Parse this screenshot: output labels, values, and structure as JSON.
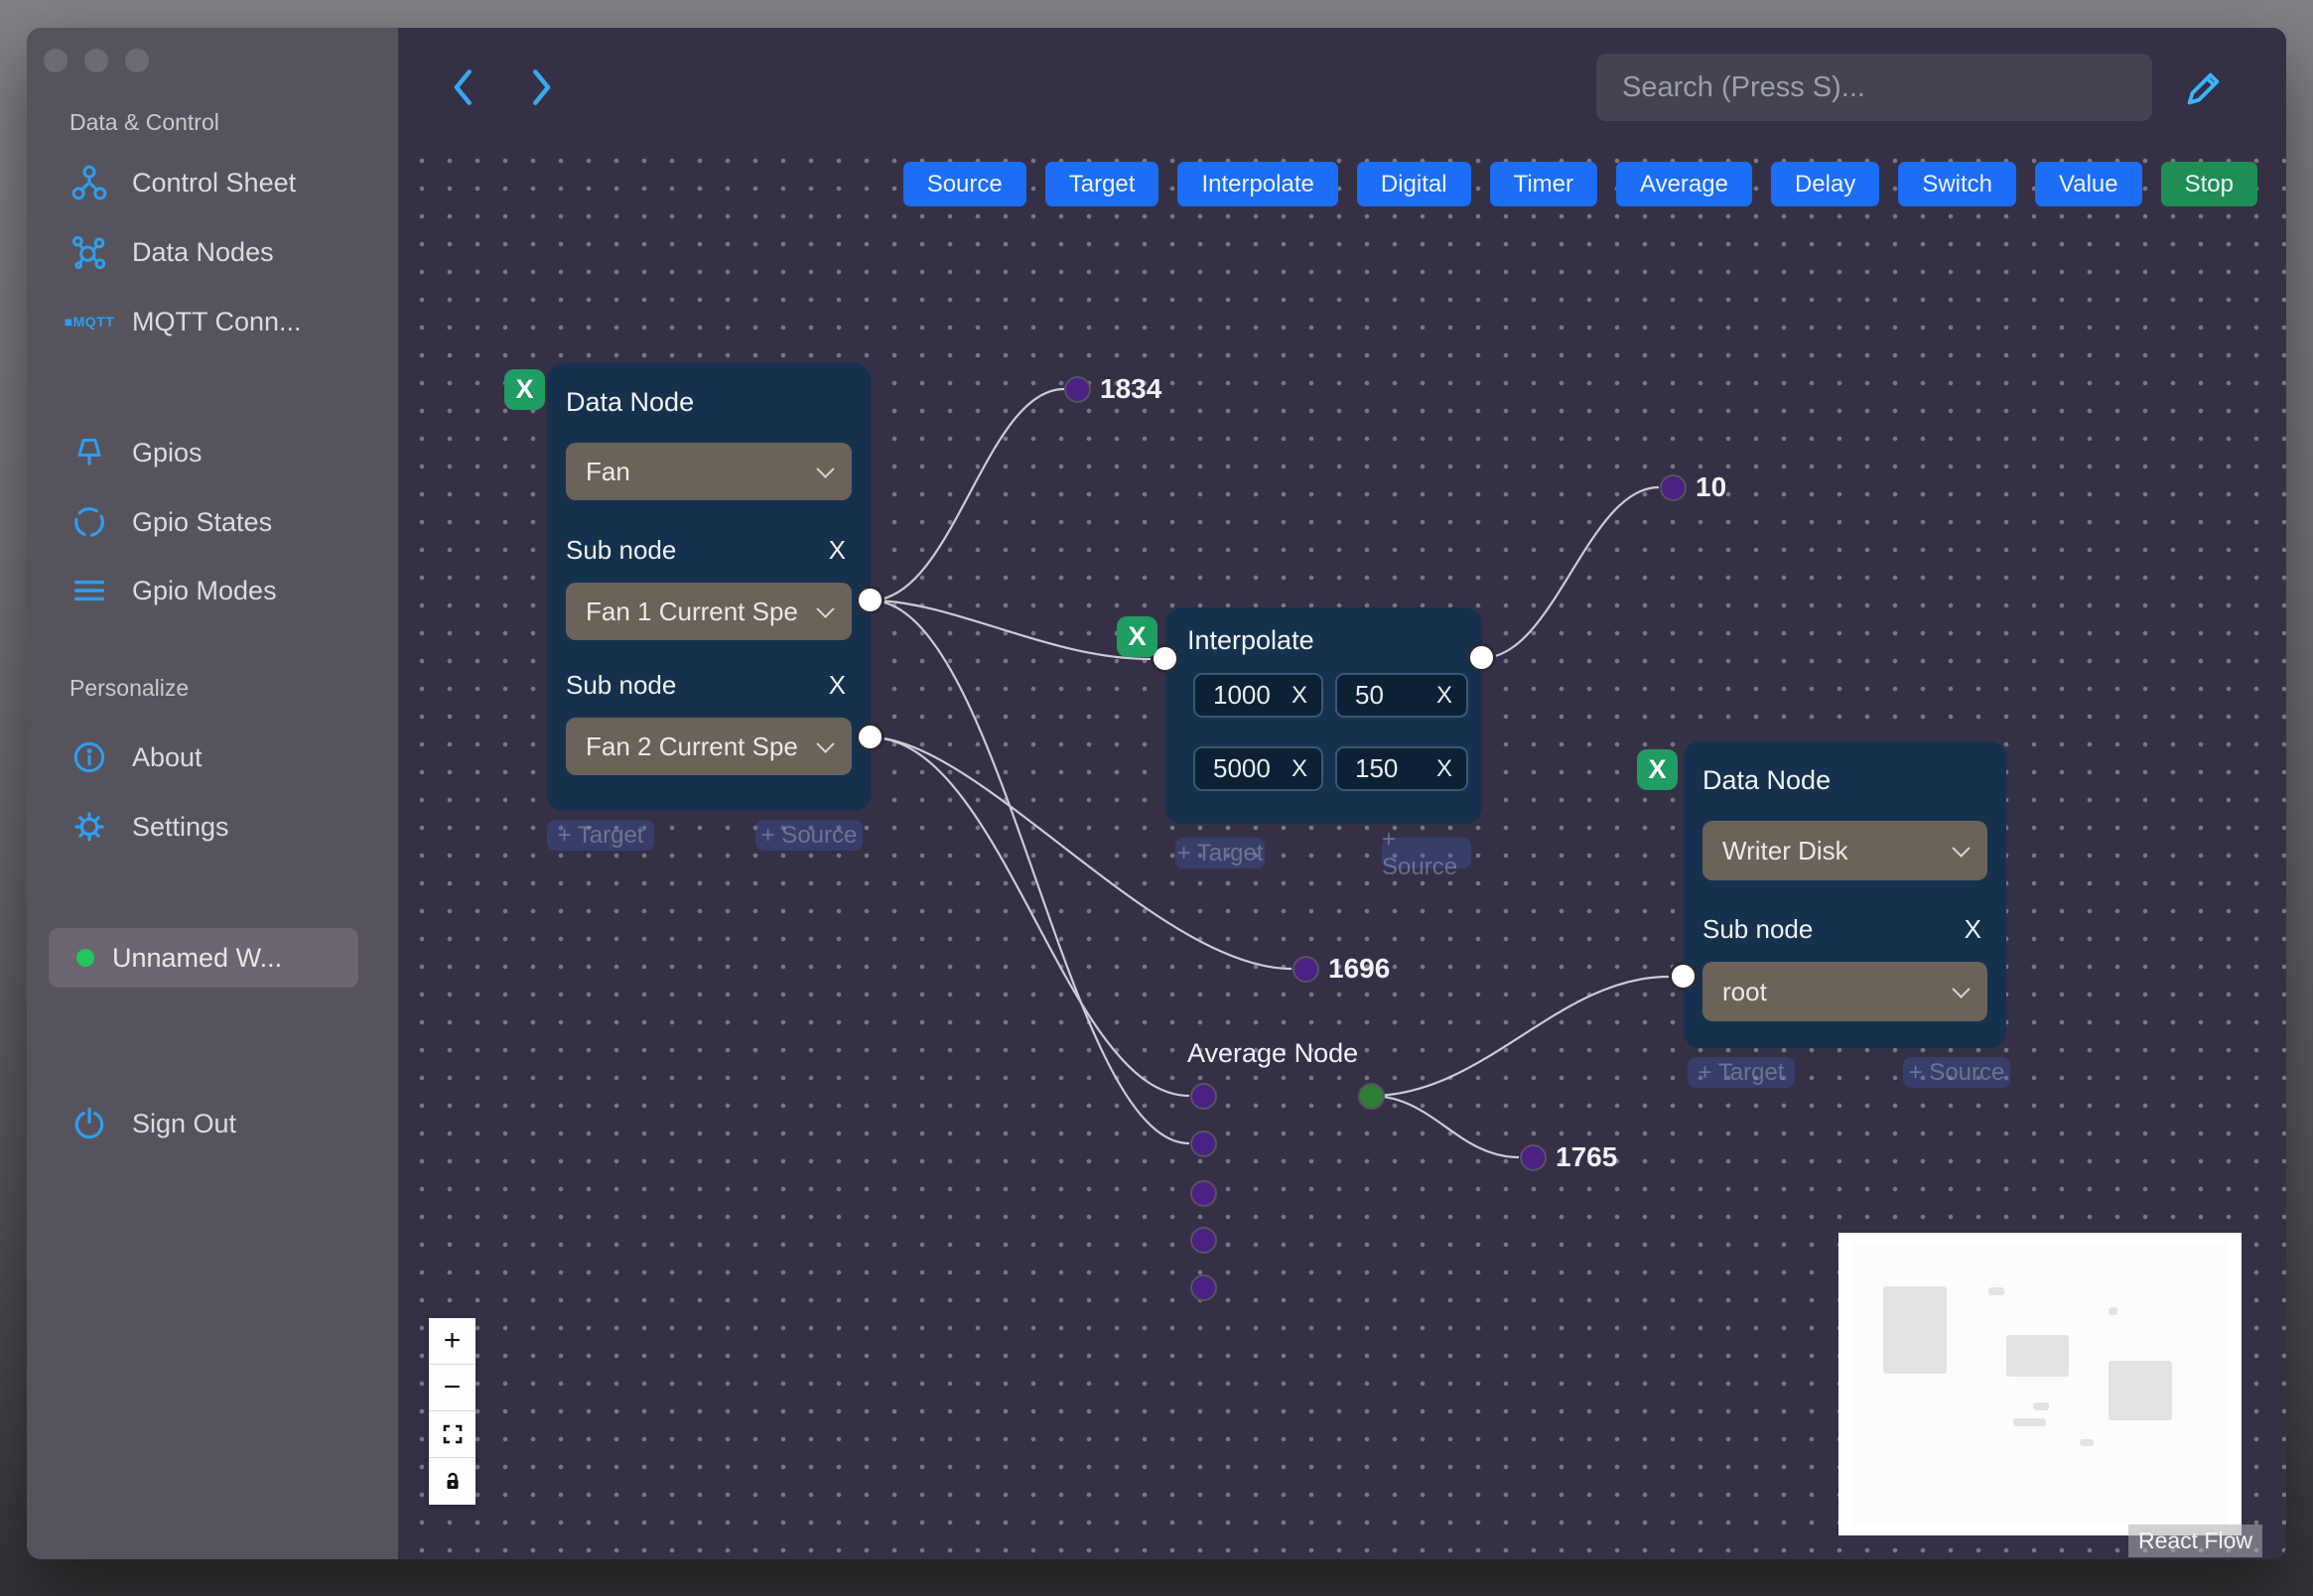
{
  "sidebar": {
    "sections": [
      {
        "title": "Data & Control",
        "items": [
          {
            "label": "Control Sheet",
            "icon": "network-icon"
          },
          {
            "label": "Data Nodes",
            "icon": "molecule-icon"
          },
          {
            "label": "MQTT Conn...",
            "icon": "mqtt-icon"
          }
        ]
      },
      {
        "title": "",
        "items": [
          {
            "label": "Gpios",
            "icon": "pin-icon"
          },
          {
            "label": "Gpio States",
            "icon": "dashed-circle-icon"
          },
          {
            "label": "Gpio Modes",
            "icon": "lines-icon"
          }
        ]
      },
      {
        "title": "Personalize",
        "items": [
          {
            "label": "About",
            "icon": "info-icon"
          },
          {
            "label": "Settings",
            "icon": "gear-icon"
          }
        ]
      }
    ],
    "workspace": {
      "label": "Unnamed W...",
      "status_color": "#22c55e"
    },
    "sign_out": "Sign Out"
  },
  "topbar": {
    "search_placeholder": "Search (Press S)..."
  },
  "toolbar": {
    "buttons": [
      "Source",
      "Target",
      "Interpolate",
      "Digital",
      "Timer",
      "Average",
      "Delay",
      "Switch",
      "Value",
      "Stop"
    ],
    "button_color": "#1b6ef5",
    "stop_color": "#1e8e55"
  },
  "nodes": {
    "fan": {
      "title": "Data Node",
      "device": "Fan",
      "sub1_label": "Sub node",
      "sub1_value": "Fan 1 Current Spe",
      "sub2_label": "Sub node",
      "sub2_value": "Fan 2 Current Spe"
    },
    "interpolate": {
      "title": "Interpolate",
      "values": [
        "1000",
        "50",
        "5000",
        "150"
      ]
    },
    "writer": {
      "title": "Data Node",
      "device": "Writer Disk",
      "sub_label": "Sub node",
      "sub_value": "root"
    },
    "average": {
      "title": "Average Node"
    }
  },
  "edge_labels": {
    "e1": "1834",
    "e2": "10",
    "e3": "1696",
    "e4": "1765"
  },
  "ui": {
    "close": "X",
    "add_target": "+ Target",
    "add_source": "+ Source",
    "zoom_in": "+",
    "zoom_out": "−"
  },
  "attribution": {
    "label": "React Flow"
  },
  "colors": {
    "canvas_bg": "#353046",
    "sidebar_bg": "#57535c",
    "node_bg": "#16314e",
    "dropdown_bg": "#6b6259",
    "accent_blue": "#1b6ef5",
    "delete_green": "#1f9d62",
    "stop_green": "#1e8e55",
    "icon_blue": "#2e9ff2",
    "edge_color": "#cbccd4",
    "handle_purple": "#4b2183",
    "handle_green": "#2e7d34",
    "workspace_status": "#22c55e"
  }
}
